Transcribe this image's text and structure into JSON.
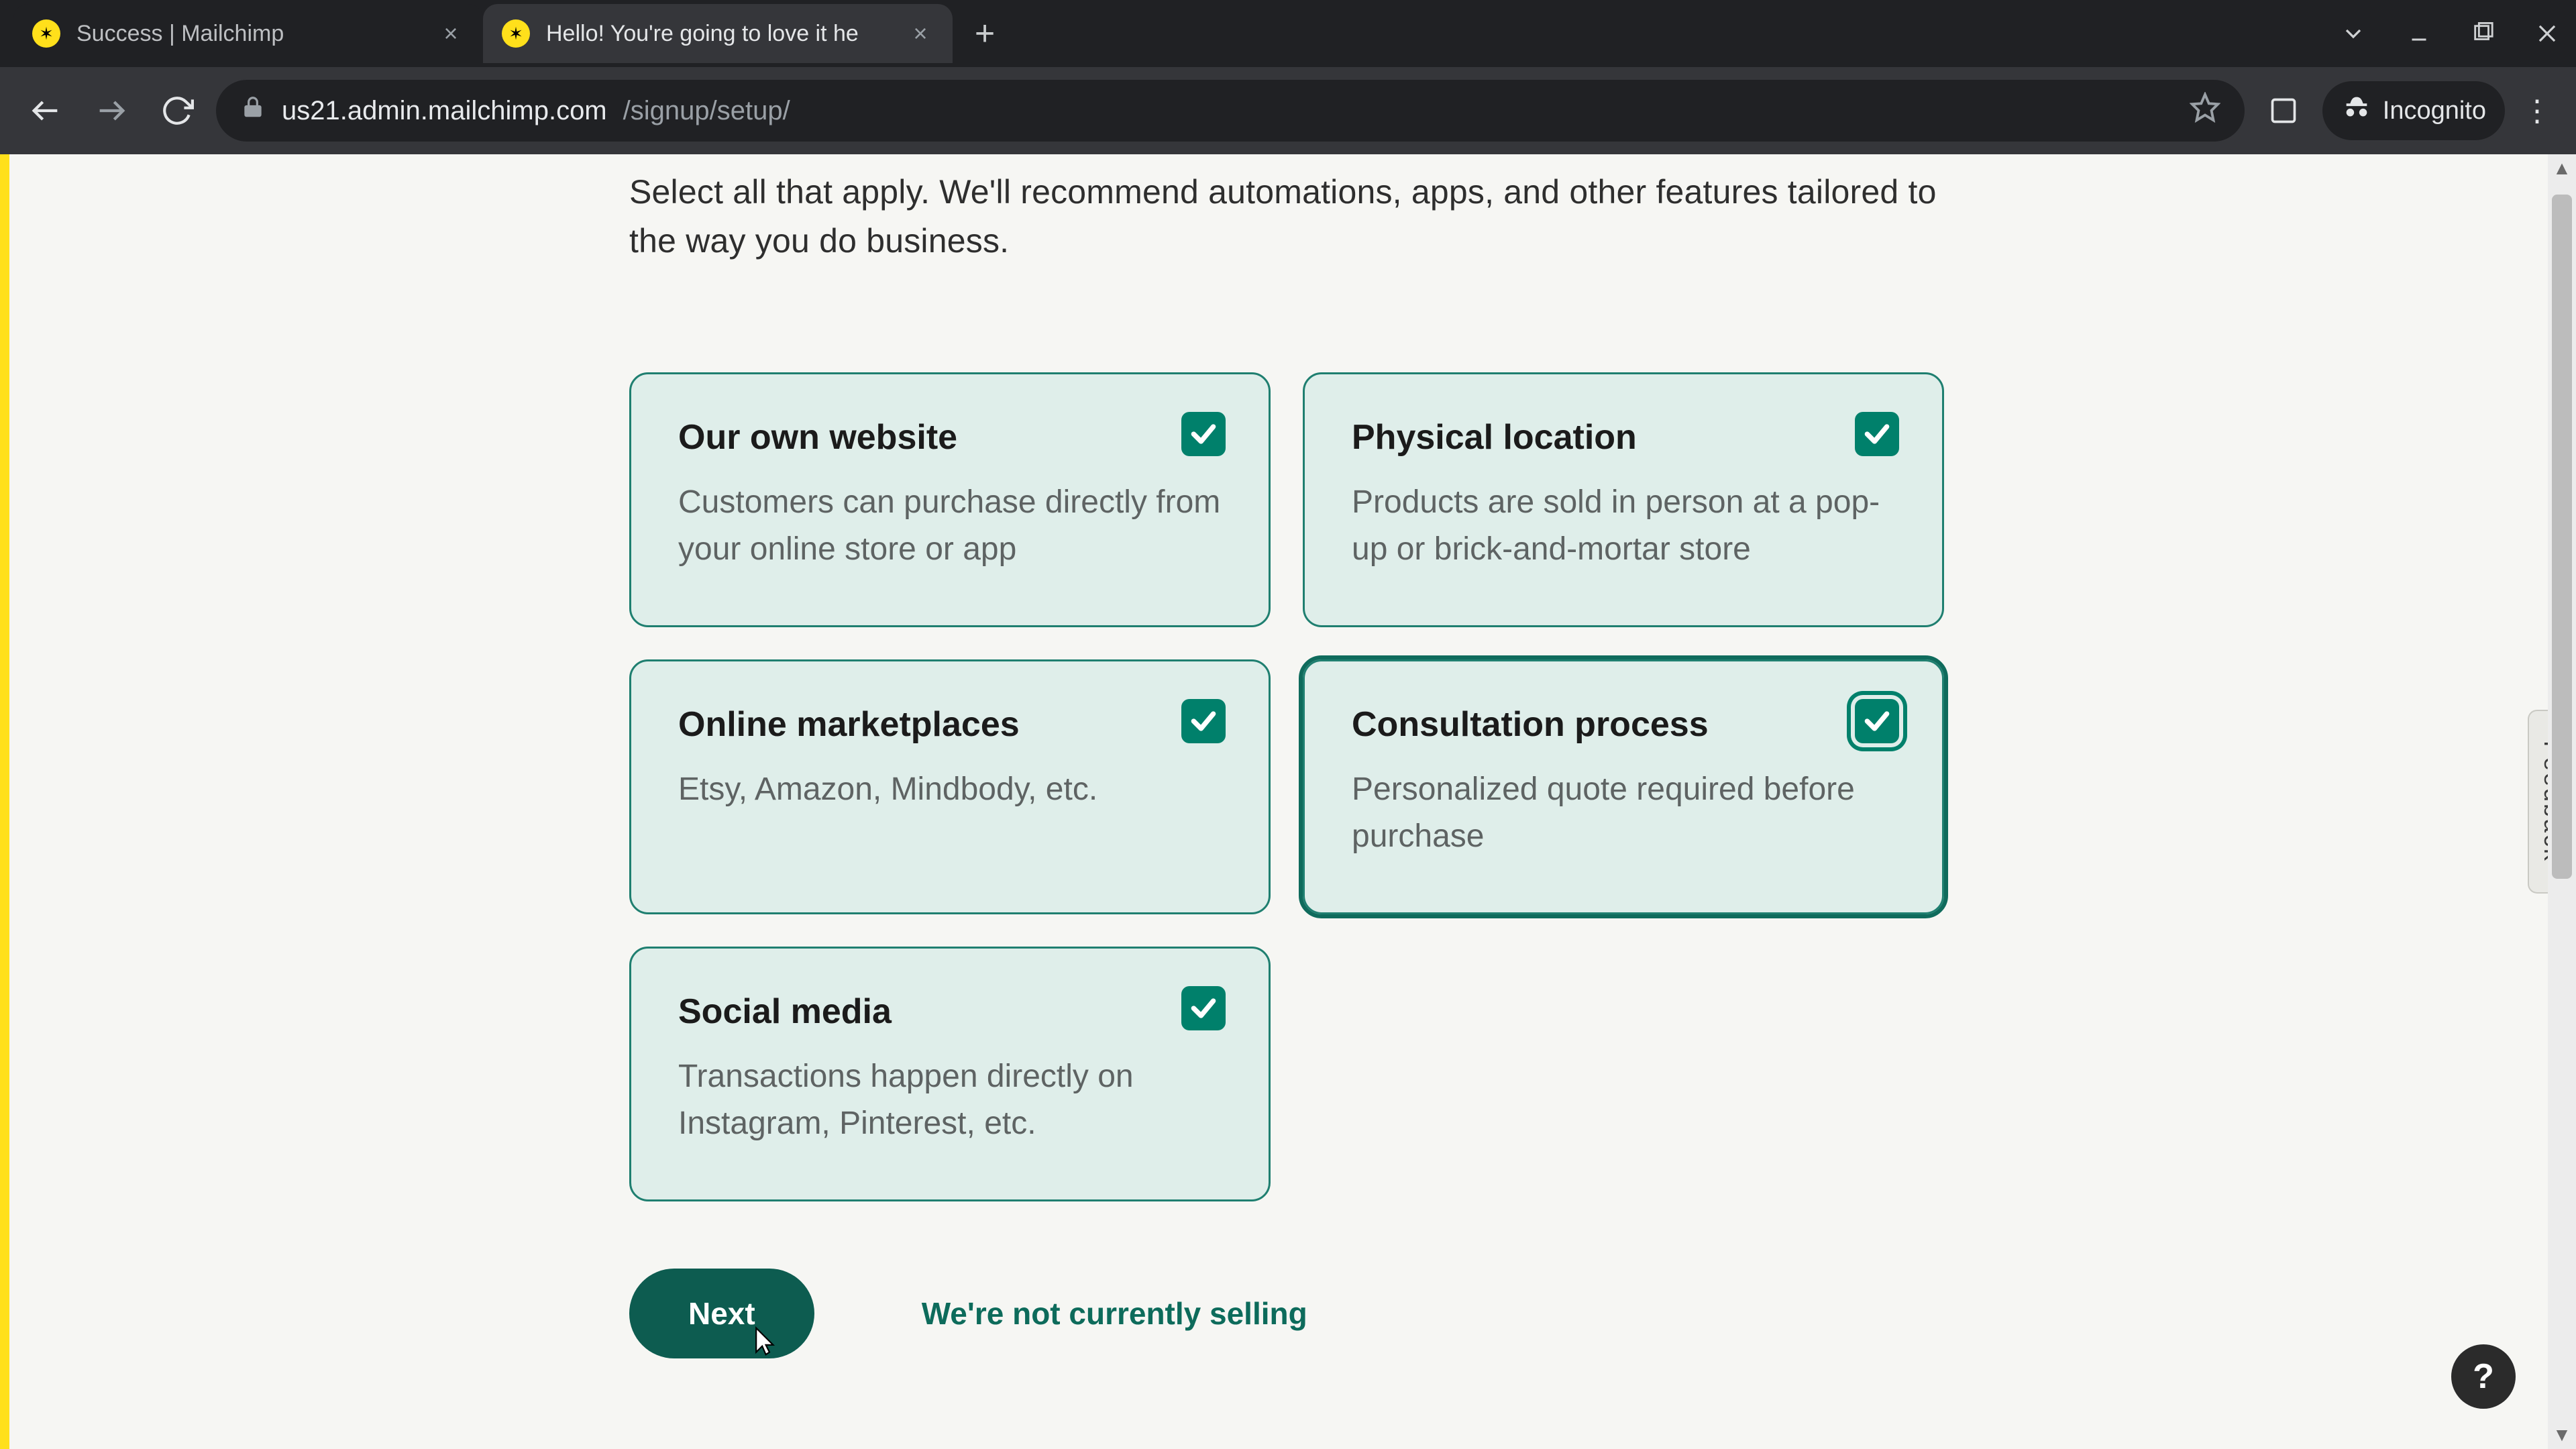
{
  "browser": {
    "tabs": [
      {
        "title": "Success | Mailchimp",
        "active": false
      },
      {
        "title": "Hello! You're going to love it he",
        "active": true
      }
    ],
    "url_host": "us21.admin.mailchimp.com",
    "url_path": "/signup/setup/",
    "incognito_label": "Incognito"
  },
  "page": {
    "intro": "Select all that apply. We'll recommend automations, apps, and other features tailored to the way you do business.",
    "cards": [
      {
        "title": "Our own website",
        "sub": "Customers can purchase directly from your online store or app",
        "checked": true
      },
      {
        "title": "Physical location",
        "sub": "Products are sold in person at a pop-up or brick-and-mortar store",
        "checked": true
      },
      {
        "title": "Online marketplaces",
        "sub": "Etsy, Amazon, Mindbody, etc.",
        "checked": true
      },
      {
        "title": "Consultation process",
        "sub": "Personalized quote required before purchase",
        "checked": true,
        "focused": true
      },
      {
        "title": "Social media",
        "sub": "Transactions happen directly on Instagram, Pinterest, etc.",
        "checked": true
      }
    ],
    "next_label": "Next",
    "skip_label": "We're not currently selling",
    "feedback_label": "Feedback",
    "help_label": "?"
  }
}
